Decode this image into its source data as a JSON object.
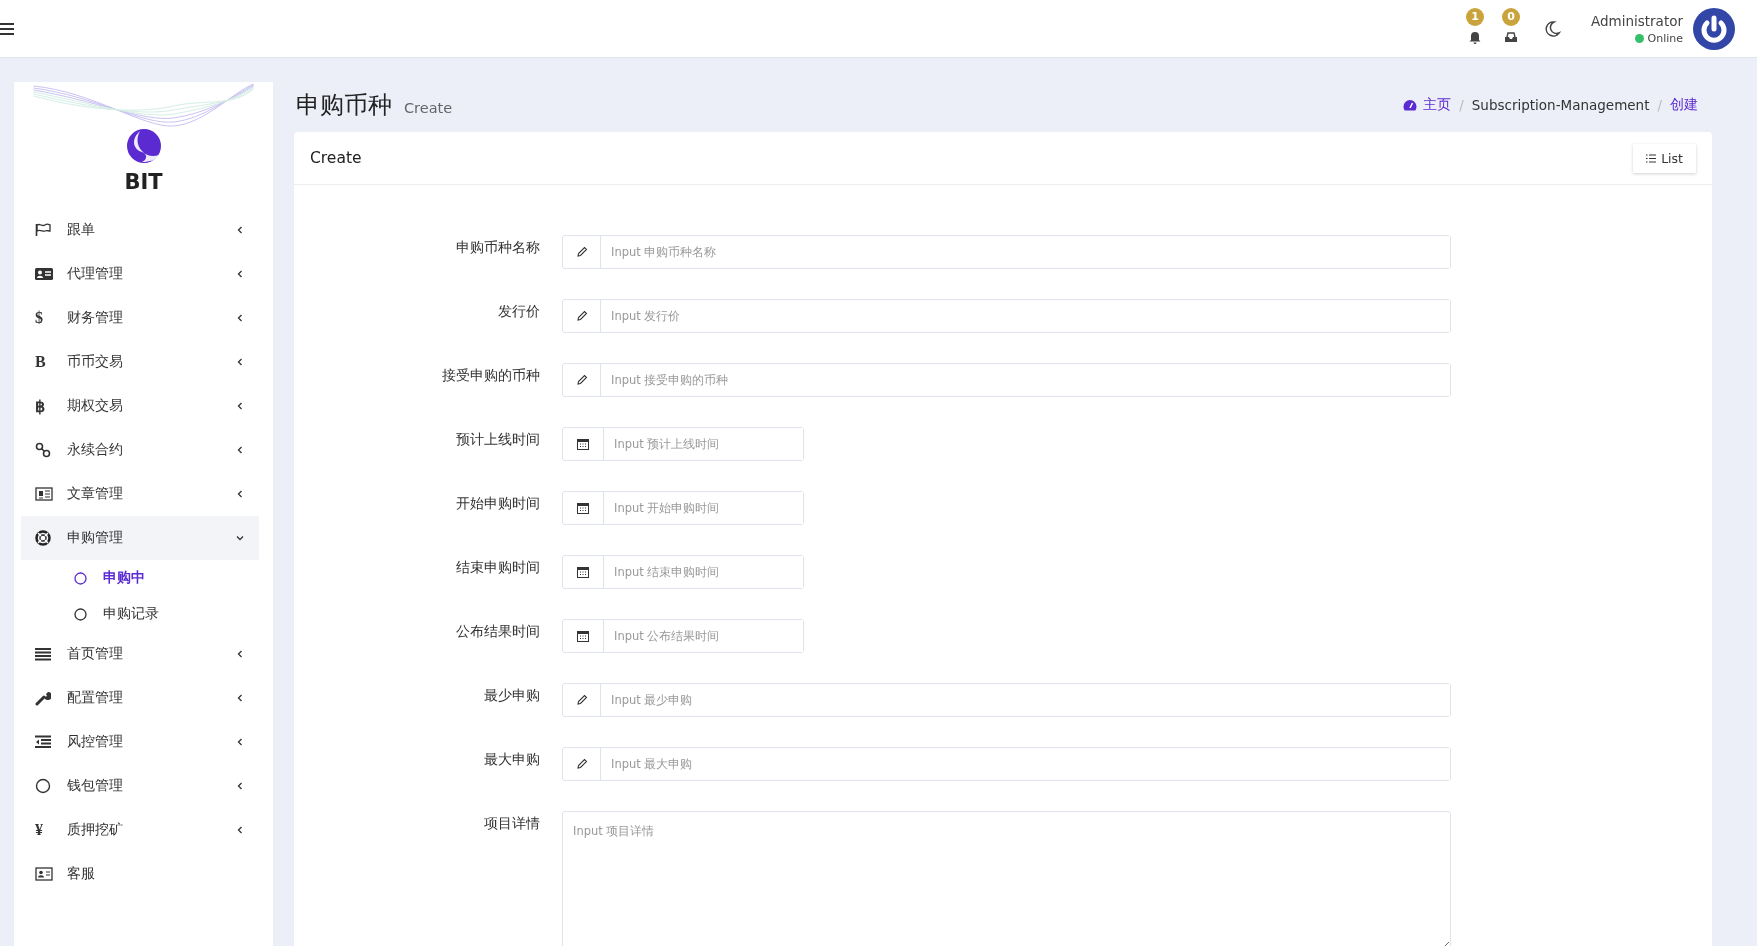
{
  "header": {
    "notifications": [
      {
        "count": "1"
      },
      {
        "count": "0"
      }
    ],
    "user": {
      "name": "Administrator",
      "status": "Online"
    }
  },
  "sidebar": {
    "brand": "BIT",
    "items": [
      {
        "label": "跟单",
        "expanded": false
      },
      {
        "label": "代理管理",
        "expanded": false
      },
      {
        "label": "财务管理",
        "glyph": "$",
        "expanded": false
      },
      {
        "label": "币币交易",
        "glyph": "B",
        "expanded": false
      },
      {
        "label": "期权交易",
        "glyph": "฿",
        "expanded": false
      },
      {
        "label": "永续合约",
        "expanded": false
      },
      {
        "label": "文章管理",
        "expanded": false
      },
      {
        "label": "申购管理",
        "expanded": true,
        "children": [
          {
            "label": "申购中",
            "selected": true
          },
          {
            "label": "申购记录",
            "selected": false
          }
        ]
      },
      {
        "label": "首页管理",
        "expanded": false
      },
      {
        "label": "配置管理",
        "expanded": false
      },
      {
        "label": "风控管理",
        "expanded": false
      },
      {
        "label": "钱包管理",
        "expanded": false
      },
      {
        "label": "质押挖矿",
        "glyph": "¥",
        "expanded": false
      },
      {
        "label": "客服"
      }
    ]
  },
  "page": {
    "title": "申购币种",
    "subtitle": "Create",
    "breadcrumb_separator": "/",
    "breadcrumb": [
      {
        "label": "主页",
        "kind": "link"
      },
      {
        "label": "Subscription-Management",
        "kind": "text"
      },
      {
        "label": "创建",
        "kind": "current"
      }
    ]
  },
  "card": {
    "title": "Create",
    "list_button": "List",
    "fields": [
      {
        "label": "申购币种名称",
        "kind": "text",
        "placeholder": "Input 申购币种名称"
      },
      {
        "label": "发行价",
        "kind": "text",
        "placeholder": "Input 发行价"
      },
      {
        "label": "接受申购的币种",
        "kind": "text",
        "placeholder": "Input 接受申购的币种"
      },
      {
        "label": "预计上线时间",
        "kind": "datetime",
        "placeholder": "Input 预计上线时间"
      },
      {
        "label": "开始申购时间",
        "kind": "datetime",
        "placeholder": "Input 开始申购时间"
      },
      {
        "label": "结束申购时间",
        "kind": "datetime",
        "placeholder": "Input 结束申购时间"
      },
      {
        "label": "公布结果时间",
        "kind": "datetime",
        "placeholder": "Input 公布结果时间"
      },
      {
        "label": "最少申购",
        "kind": "text",
        "placeholder": "Input 最少申购"
      },
      {
        "label": "最大申购",
        "kind": "text",
        "placeholder": "Input 最大申购"
      },
      {
        "label": "项目详情",
        "kind": "textarea",
        "placeholder": "Input 项目详情"
      }
    ]
  }
}
